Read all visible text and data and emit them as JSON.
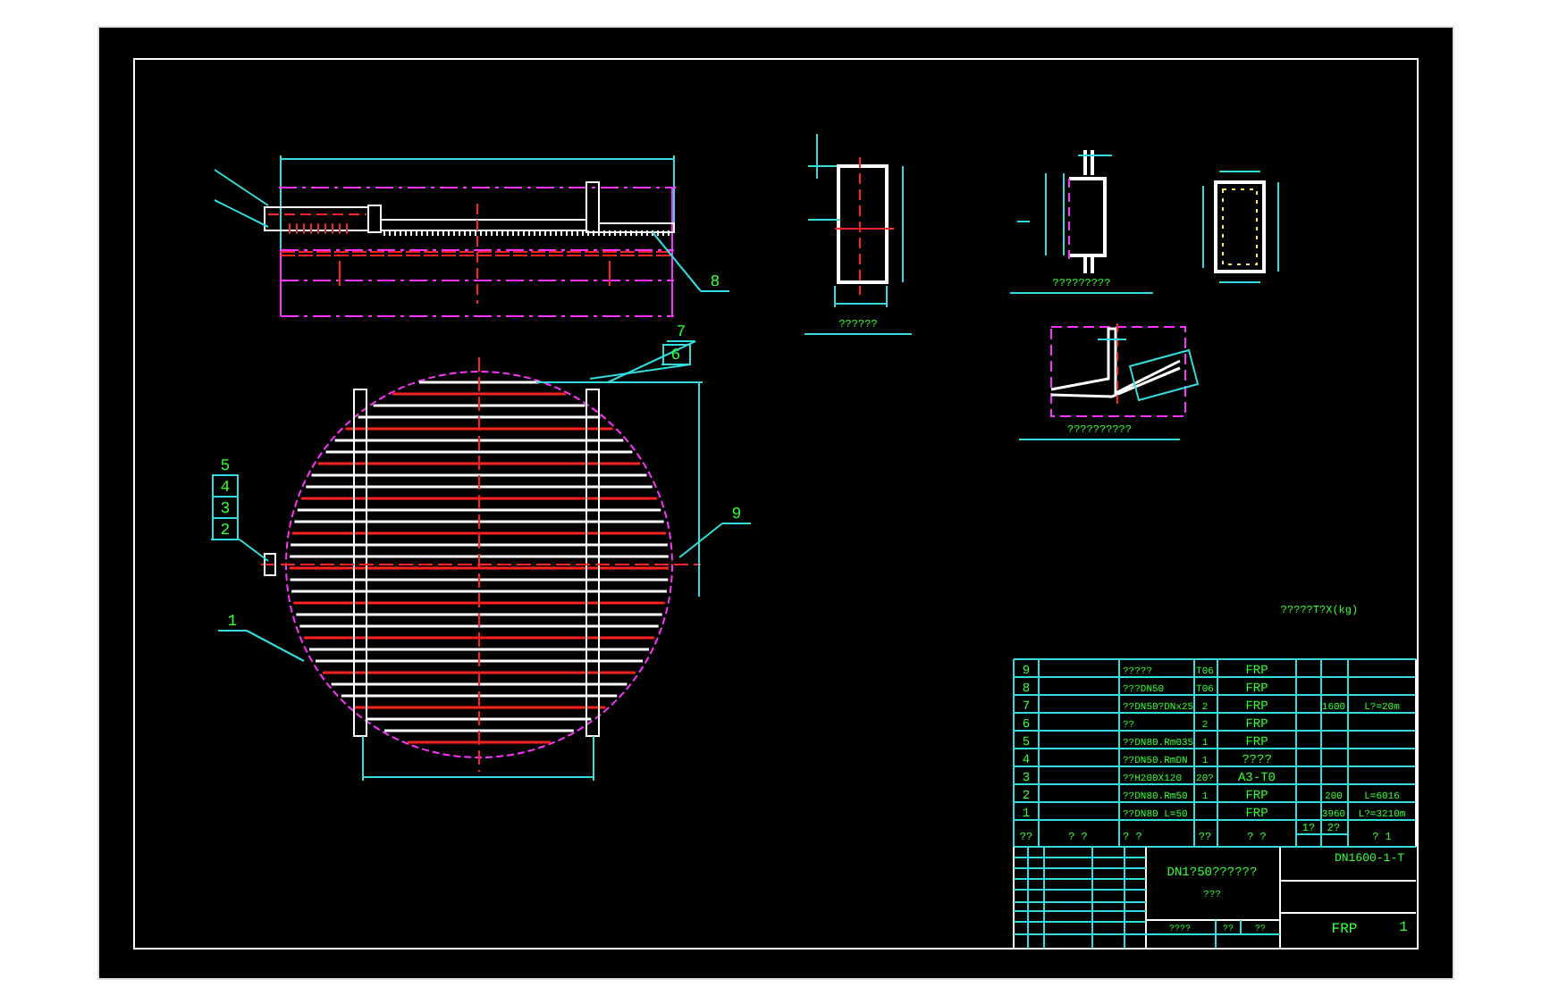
{
  "callouts": [
    "8",
    "7",
    "6",
    "5",
    "4",
    "3",
    "2",
    "1",
    "9"
  ],
  "captions": [
    "??????",
    "?????????",
    "??????????",
    "?????T?X(kg)"
  ],
  "parts_list": {
    "rows": [
      {
        "no": "9",
        "name": "?????",
        "qty": "T06",
        "material": "FRP"
      },
      {
        "no": "8",
        "name": "???DN50",
        "qty": "T06",
        "material": "FRP"
      },
      {
        "no": "7",
        "name": "??DN50?DNx25",
        "qty": "2",
        "material": "FRP",
        "unit_weight": "1600",
        "remark": "L?=20m"
      },
      {
        "no": "6",
        "name": "??",
        "qty": "2",
        "material": "FRP"
      },
      {
        "no": "5",
        "name": "??DN80.Rm035",
        "qty": "1",
        "material": "FRP"
      },
      {
        "no": "4",
        "name": "??DN50.RmDN",
        "qty": "1",
        "material": "????"
      },
      {
        "no": "3",
        "name": "??H200X120",
        "qty": "20?",
        "material": "A3-T0"
      },
      {
        "no": "2",
        "name": "??DN80.Rm50",
        "qty": "1",
        "material": "FRP",
        "unit_weight": "200",
        "remark": "L=6016"
      },
      {
        "no": "1",
        "name": "??DN80 L=50",
        "material": "FRP",
        "unit_weight": "3960",
        "remark": "L?=3210m"
      }
    ],
    "header": {
      "no": "??",
      "code": "? ?",
      "name": "? ?",
      "qty": "??",
      "material": "? ?",
      "mass_1": "1?",
      "mass_2": "2?",
      "remark": "? 1"
    }
  },
  "title_block": {
    "drawing_number": "DN1600-1-T",
    "title": "DN1?50??????",
    "subtitle": "???",
    "labels": [
      "????",
      "??",
      "??"
    ],
    "material": "FRP",
    "sheet": "1"
  }
}
